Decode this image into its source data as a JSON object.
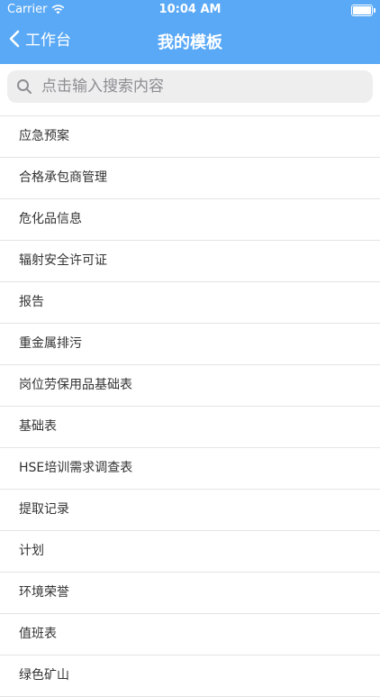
{
  "status": {
    "carrier": "Carrier",
    "time": "10:04 AM"
  },
  "nav": {
    "back_label": "工作台",
    "title": "我的模板"
  },
  "search": {
    "placeholder": "点击输入搜索内容"
  },
  "templates": [
    "应急预案",
    "合格承包商管理",
    "危化品信息",
    "辐射安全许可证",
    "报告",
    "重金属排污",
    "岗位劳保用品基础表",
    "基础表",
    "HSE培训需求调查表",
    "提取记录",
    "计划",
    "环境荣誉",
    "值班表",
    "绿色矿山"
  ]
}
